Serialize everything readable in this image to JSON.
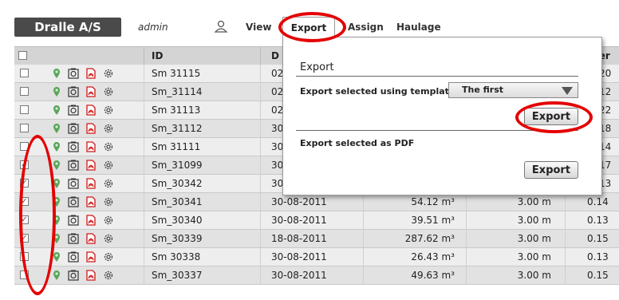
{
  "header": {
    "brand": "Dralle A/S",
    "user": "admin",
    "menu": {
      "view": "View",
      "export": "Export",
      "assign": "Assign",
      "haulage": "Haulage"
    }
  },
  "table": {
    "columns": {
      "id": "ID",
      "date": "D",
      "last": "ter"
    },
    "rows": [
      {
        "id": "Sm 31115",
        "date": "02",
        "checked": false
      },
      {
        "id": "Sm_31114",
        "date": "02",
        "checked": false
      },
      {
        "id": "Sm 31113",
        "date": "02",
        "checked": false
      },
      {
        "id": "Sm_31112",
        "date": "30",
        "checked": false
      },
      {
        "id": "Sm 31111",
        "date": "30",
        "checked": false
      },
      {
        "id": "Sm_31099",
        "date": "30",
        "checked": true
      },
      {
        "id": "Sm_30342",
        "date": "30",
        "checked": true
      },
      {
        "id": "Sm_30341",
        "date": "30-08-2011",
        "volume": "54.12 m³",
        "length": "3.00 m",
        "last": "0.14",
        "checked": true
      },
      {
        "id": "Sm_30340",
        "date": "30-08-2011",
        "volume": "39.51 m³",
        "length": "3.00 m",
        "last": "0.13",
        "checked": true
      },
      {
        "id": "Sm_30339",
        "date": "18-08-2011",
        "volume": "287.62 m³",
        "length": "3.00 m",
        "last": "0.15",
        "checked": true
      },
      {
        "id": "Sm 30338",
        "date": "30-08-2011",
        "volume": "26.43 m³",
        "length": "3.00 m",
        "last": "0.13",
        "checked": false
      },
      {
        "id": "Sm_30337",
        "date": "30-08-2011",
        "volume": "49.63 m³",
        "length": "3.00 m",
        "last": "0.15",
        "checked": false
      }
    ],
    "right_edge_partial": [
      "20",
      "12",
      "22",
      "18",
      "14",
      "17",
      "13"
    ]
  },
  "export_panel": {
    "title": "Export",
    "template_label": "Export selected using template:",
    "template_value": "The first",
    "export_button_1": "Export",
    "pdf_label": "Export selected as PDF",
    "export_button_2": "Export"
  },
  "colors": {
    "annotation": "#e40000",
    "brand_bg": "#4a4a4a"
  }
}
